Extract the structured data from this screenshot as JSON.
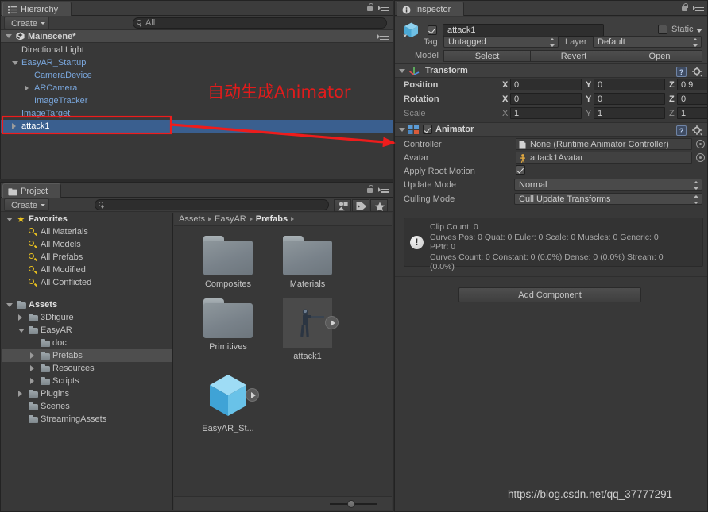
{
  "hierarchy": {
    "tab_label": "Hierarchy",
    "tab_icon": "hierarchy-list-icon",
    "create_label": "Create",
    "search_placeholder": "All",
    "search_value": "",
    "scene_name": "Mainscene*",
    "items": [
      {
        "label": "Directional Light",
        "depth": 1,
        "arrow": "none",
        "color": "gray"
      },
      {
        "label": "EasyAR_Startup",
        "depth": 1,
        "arrow": "down",
        "color": "prefab"
      },
      {
        "label": "CameraDevice",
        "depth": 2,
        "arrow": "none",
        "color": "prefab"
      },
      {
        "label": "ARCamera",
        "depth": 2,
        "arrow": "right",
        "color": "prefab"
      },
      {
        "label": "ImageTracker",
        "depth": 2,
        "arrow": "none",
        "color": "prefab"
      },
      {
        "label": "ImageTarget",
        "depth": 1,
        "arrow": "none",
        "color": "prefab"
      },
      {
        "label": "attack1",
        "depth": 1,
        "arrow": "right",
        "color": "prefab",
        "selected": true
      }
    ]
  },
  "inspector": {
    "tab_label": "Inspector",
    "tab_icon": "info-circle-icon",
    "object_name": "attack1",
    "object_enabled": true,
    "static_label": "Static",
    "static_checked": false,
    "tag_label": "Tag",
    "tag_value": "Untagged",
    "layer_label": "Layer",
    "layer_value": "Default",
    "model_label": "Model",
    "model_buttons": [
      "Select",
      "Revert",
      "Open"
    ],
    "transform": {
      "title": "Transform",
      "rows": [
        {
          "label": "Position",
          "x": "0",
          "y": "0",
          "z": "0.9",
          "dim": false
        },
        {
          "label": "Rotation",
          "x": "0",
          "y": "0",
          "z": "0",
          "dim": false
        },
        {
          "label": "Scale",
          "x": "1",
          "y": "1",
          "z": "1",
          "dim": true
        }
      ],
      "axes": [
        "X",
        "Y",
        "Z"
      ]
    },
    "animator": {
      "title": "Animator",
      "enabled": true,
      "controller_label": "Controller",
      "controller_value": "None (Runtime Animator Controller)",
      "avatar_label": "Avatar",
      "avatar_value": "attack1Avatar",
      "apply_root_motion_label": "Apply Root Motion",
      "apply_root_motion_checked": true,
      "update_mode_label": "Update Mode",
      "update_mode_value": "Normal",
      "culling_mode_label": "Culling Mode",
      "culling_mode_value": "Cull Update Transforms",
      "info_lines": [
        "Clip Count: 0",
        "Curves Pos: 0 Quat: 0 Euler: 0 Scale: 0 Muscles: 0 Generic: 0",
        "PPtr: 0",
        "Curves Count: 0 Constant: 0 (0.0%) Dense: 0 (0.0%) Stream: 0",
        "(0.0%)"
      ]
    },
    "add_component_label": "Add Component"
  },
  "project": {
    "tab_label": "Project",
    "tab_icon": "folder-icon",
    "create_label": "Create",
    "search_placeholder": "",
    "search_value": "",
    "filter_icons": [
      "filter-by-type-icon",
      "filter-by-label-icon",
      "favorite-star-icon"
    ],
    "breadcrumb": [
      "Assets",
      "EasyAR",
      "Prefabs"
    ],
    "tree": [
      {
        "label": "Favorites",
        "depth": 0,
        "arrow": "down",
        "icon": "star-icon",
        "bold": true
      },
      {
        "label": "All Materials",
        "depth": 1,
        "arrow": "none",
        "icon": "search-icon"
      },
      {
        "label": "All Models",
        "depth": 1,
        "arrow": "none",
        "icon": "search-icon"
      },
      {
        "label": "All Prefabs",
        "depth": 1,
        "arrow": "none",
        "icon": "search-icon"
      },
      {
        "label": "All Modified",
        "depth": 1,
        "arrow": "none",
        "icon": "search-icon"
      },
      {
        "label": "All Conflicted",
        "depth": 1,
        "arrow": "none",
        "icon": "search-icon"
      },
      {
        "label": "",
        "depth": 0,
        "arrow": "none",
        "icon": "none"
      },
      {
        "label": "Assets",
        "depth": 0,
        "arrow": "down",
        "icon": "folder-icon",
        "bold": true
      },
      {
        "label": "3Dfigure",
        "depth": 1,
        "arrow": "right",
        "icon": "folder-icon"
      },
      {
        "label": "EasyAR",
        "depth": 1,
        "arrow": "down",
        "icon": "folder-icon"
      },
      {
        "label": "doc",
        "depth": 2,
        "arrow": "none",
        "icon": "folder-icon"
      },
      {
        "label": "Prefabs",
        "depth": 2,
        "arrow": "right",
        "icon": "folder-icon",
        "selected": true
      },
      {
        "label": "Resources",
        "depth": 2,
        "arrow": "right",
        "icon": "folder-icon"
      },
      {
        "label": "Scripts",
        "depth": 2,
        "arrow": "right",
        "icon": "folder-icon"
      },
      {
        "label": "Plugins",
        "depth": 1,
        "arrow": "right",
        "icon": "folder-icon"
      },
      {
        "label": "Scenes",
        "depth": 1,
        "arrow": "none",
        "icon": "folder-icon"
      },
      {
        "label": "StreamingAssets",
        "depth": 1,
        "arrow": "none",
        "icon": "folder-icon"
      }
    ],
    "assets": [
      {
        "name": "Composites",
        "kind": "folder"
      },
      {
        "name": "Materials",
        "kind": "folder"
      },
      {
        "name": "Primitives",
        "kind": "folder"
      },
      {
        "name": "attack1",
        "kind": "model-prefab"
      },
      {
        "name": "EasyAR_St...",
        "kind": "cube-prefab"
      }
    ]
  },
  "annotations": {
    "note_text": "自动生成Animator",
    "note_color": "#e21b1b",
    "highlight_color": "#ee1c1c",
    "arrow_color": "#ee1c1c"
  },
  "watermark": {
    "url": "https://blog.csdn.net/qq_37777291"
  }
}
